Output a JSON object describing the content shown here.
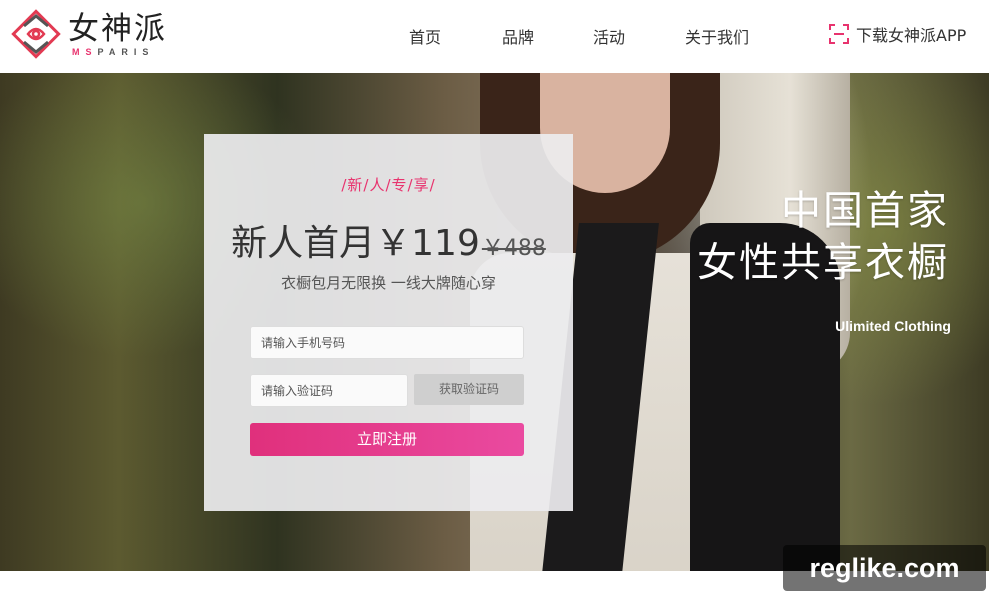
{
  "brand": {
    "name_cn": "女神派",
    "name_en_accent": "MS",
    "name_en_rest": "PARIS",
    "accent_color": "#e8336e"
  },
  "nav": {
    "items": [
      {
        "label": "首页"
      },
      {
        "label": "品牌"
      },
      {
        "label": "活动"
      },
      {
        "label": "关于我们"
      }
    ],
    "download_label": "下载女神派APP",
    "download_icon": "app-scan-icon"
  },
  "hero": {
    "title_line1": "中国首家",
    "title_line2": "女性共享衣橱",
    "subtitle": "Ulimited Clothing"
  },
  "signup": {
    "tagline": "/新/人/专/享/",
    "offer": "新人首月￥119",
    "original_price": "￥488",
    "description": "衣橱包月无限换 一线大牌随心穿",
    "phone_placeholder": "请输入手机号码",
    "code_placeholder": "请输入验证码",
    "get_code_label": "获取验证码",
    "register_label": "立即注册",
    "button_color": "#e0307c"
  },
  "watermark": {
    "text": "reglike.com"
  }
}
